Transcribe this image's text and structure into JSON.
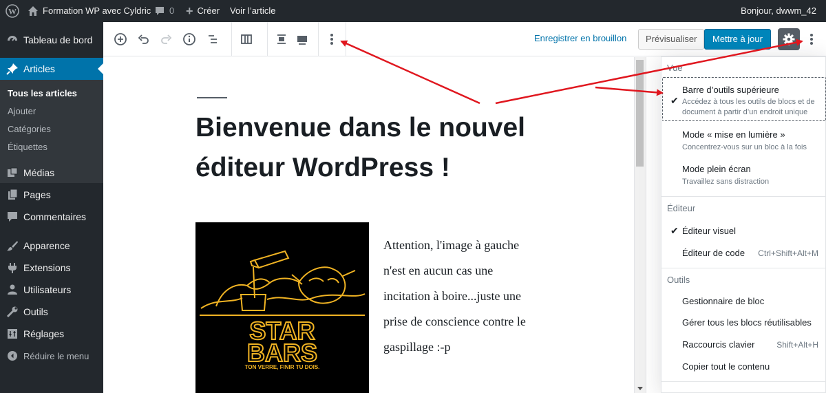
{
  "adminbar": {
    "site_title": "Formation WP avec Cyldric",
    "comments_count": "0",
    "new_label": "Créer",
    "view_label": "Voir l’article",
    "greeting": "Bonjour, dwwm_42"
  },
  "sidebar": {
    "items": [
      {
        "label": "Tableau de bord",
        "icon": "dashboard-icon"
      },
      {
        "label": "Articles",
        "icon": "pin-icon"
      },
      {
        "label": "Médias",
        "icon": "media-icon"
      },
      {
        "label": "Pages",
        "icon": "pages-icon"
      },
      {
        "label": "Commentaires",
        "icon": "comments-icon"
      },
      {
        "label": "Apparence",
        "icon": "appearance-icon"
      },
      {
        "label": "Extensions",
        "icon": "plugins-icon"
      },
      {
        "label": "Utilisateurs",
        "icon": "users-icon"
      },
      {
        "label": "Outils",
        "icon": "tools-icon"
      },
      {
        "label": "Réglages",
        "icon": "settings-icon"
      },
      {
        "label": "Réduire le menu",
        "icon": "collapse-icon"
      }
    ],
    "submenu": [
      "Tous les articles",
      "Ajouter",
      "Catégories",
      "Étiquettes"
    ]
  },
  "header": {
    "save_draft": "Enregistrer en brouillon",
    "preview": "Prévisualiser",
    "update": "Mettre à jour"
  },
  "post": {
    "title": "Bienvenue dans le nouvel éditeur WordPress !",
    "body": "Attention, l'image à gauche n'est en aucun cas une incitation à boire...juste une prise de conscience contre le gaspillage :-p",
    "poster_title_line1": "STAR",
    "poster_title_line2": "BARS",
    "poster_tagline": "TON VERRE, FINIR TU DOIS."
  },
  "dropdown": {
    "vue_label": "Vue",
    "top_toolbar": "Barre d’outils supérieure",
    "top_toolbar_help": "Accédez à tous les outils de blocs et de document à partir d’un endroit unique",
    "spotlight": "Mode « mise en lumière »",
    "spotlight_help": "Concentrez-vous sur un bloc à la fois",
    "fullscreen": "Mode plein écran",
    "fullscreen_help": "Travaillez sans distraction",
    "editor_label": "Éditeur",
    "visual_editor": "Éditeur visuel",
    "code_editor": "Éditeur de code",
    "code_shortcut": "Ctrl+Shift+Alt+M",
    "tools_label": "Outils",
    "block_manager": "Gestionnaire de bloc",
    "reusable_blocks": "Gérer tous les blocs réutilisables",
    "shortcuts": "Raccourcis clavier",
    "shortcuts_key": "Shift+Alt+H",
    "copy_all": "Copier tout le contenu"
  },
  "colors": {
    "admin_bg": "#23282d",
    "accent": "#0073aa",
    "primary_button": "#0085ba",
    "annotation_arrow": "#e0171f",
    "poster_gold": "#f0b323"
  }
}
